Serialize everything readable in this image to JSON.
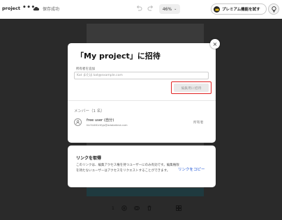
{
  "topbar": {
    "project_name": "project",
    "more_label": "•••",
    "save_status": "保存成功",
    "zoom_value": "46%",
    "zoom_chevron": "⌄",
    "premium_label": "プレミアム機能を試す"
  },
  "dialog": {
    "title": "「My project」に招待",
    "add_label": "所有者を追加",
    "input_placeholder": "Kat または kat@example.com",
    "send_button": "編集用に招待",
    "close_glyph": "×",
    "members_heading": "メンバー（1 名）",
    "member": {
      "name": "free user (自分)",
      "email": "tkr34461rtfyp@adobetest.com",
      "role": "所有者"
    }
  },
  "link_card": {
    "title": "リンクを取得",
    "description": "このリンクは、編集アクセス権を持つユーザーにのみ有効です。編集権限を持たないユーザーはアクセスをリクエストすることができます。",
    "copy_link": "リンクをコピー"
  },
  "bottom_toolbar": {
    "page_number": "1"
  },
  "colors": {
    "accent": "#1f56d6",
    "highlight": "#e02020",
    "overlay": "#2a2a2a"
  }
}
